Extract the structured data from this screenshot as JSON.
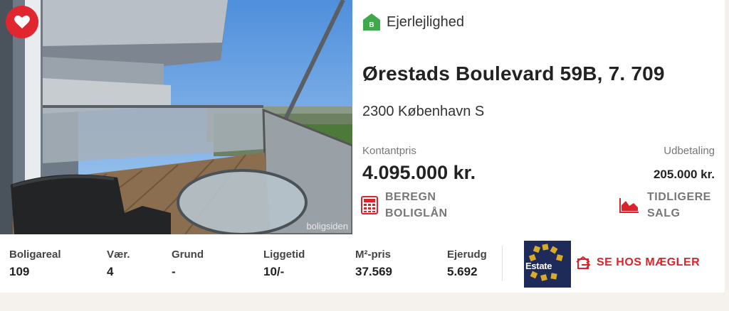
{
  "listing": {
    "property_type": "Ejerlejlighed",
    "property_type_badge": "B",
    "address": "Ørestads Boulevard 59B, 7. 709",
    "city": "2300 København S",
    "price_label": "Kontantpris",
    "price_value": "4.095.000 kr.",
    "down_payment_label": "Udbetaling",
    "down_payment_value": "205.000 kr.",
    "photo_watermark": "boligsiden"
  },
  "actions": {
    "calculate_line1": "BEREGN",
    "calculate_line2": "BOLIGLÅN",
    "history_line1": "TIDLIGERE",
    "history_line2": "SALG",
    "see_at_agent": "SE HOS MÆGLER"
  },
  "stats": [
    {
      "label": "Boligareal",
      "value": "109"
    },
    {
      "label": "Vær.",
      "value": "4"
    },
    {
      "label": "Grund",
      "value": "-"
    },
    {
      "label": "Liggetid",
      "value": "10/-"
    },
    {
      "label": "M²-pris",
      "value": "37.569"
    },
    {
      "label": "Ejerudg",
      "value": "5.692"
    }
  ],
  "agent": {
    "logo_text": "Estate"
  },
  "colors": {
    "accent_red": "#d9242c",
    "favorite_red": "#e0262f",
    "type_green": "#3ea84a",
    "estate_navy": "#1d2a5a",
    "muted_text": "#777777"
  },
  "icons": {
    "favorite": "heart-icon",
    "property_type": "house-icon",
    "calculate": "calculator-icon",
    "history": "area-chart-icon",
    "see_at_agent": "external-link-icon"
  }
}
